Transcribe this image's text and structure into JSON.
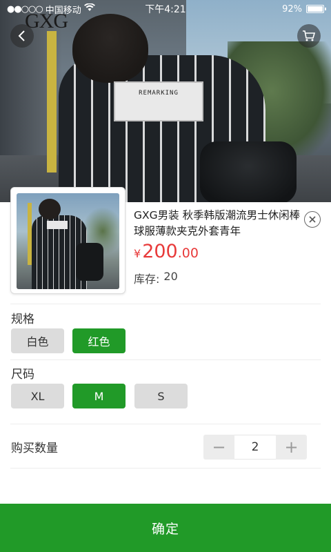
{
  "status_bar": {
    "signal": "●●○○○",
    "carrier": "中国移动",
    "wifi_icon": "wifi-icon",
    "time": "下午4:21",
    "battery_percent": "92%",
    "battery_level": 0.92
  },
  "hero": {
    "brand_logo": "GXG",
    "patch_text": "REMARKING",
    "back_icon": "chevron-left-icon",
    "cart_icon": "cart-icon"
  },
  "product": {
    "title": "GXG男装 秋季韩版潮流男士休闲棒球服薄款夹克外套青年",
    "price_symbol": "¥",
    "price_integer": "200",
    "price_decimal": ".00",
    "stock_label": "库存:",
    "stock_value": "20",
    "close_icon": "close-icon"
  },
  "spec": {
    "label": "规格",
    "options": [
      "白色",
      "红色"
    ],
    "selected": "红色"
  },
  "size": {
    "label": "尺码",
    "options": [
      "XL",
      "M",
      "S"
    ],
    "selected": "M"
  },
  "quantity": {
    "label": "购买数量",
    "minus": "−",
    "value": "2",
    "plus": "+"
  },
  "confirm_label": "确定",
  "colors": {
    "accent_green": "#219a28",
    "price_red": "#e83a3a",
    "chip_gray": "#dcdcdc"
  }
}
